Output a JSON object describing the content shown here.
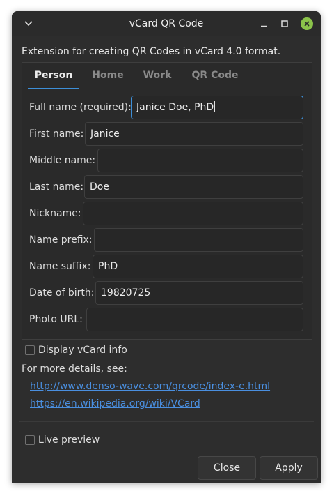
{
  "window": {
    "title": "vCard QR Code",
    "description": "Extension for creating QR Codes in vCard 4.0 format."
  },
  "tabs": [
    {
      "label": "Person",
      "active": true
    },
    {
      "label": "Home",
      "active": false
    },
    {
      "label": "Work",
      "active": false
    },
    {
      "label": "QR Code",
      "active": false
    }
  ],
  "fields": {
    "full_name": {
      "label": "Full name (required):",
      "value": "Janice Doe, PhD"
    },
    "first_name": {
      "label": "First name:",
      "value": "Janice"
    },
    "middle_name": {
      "label": "Middle name:",
      "value": ""
    },
    "last_name": {
      "label": "Last name:",
      "value": "Doe"
    },
    "nickname": {
      "label": "Nickname:",
      "value": ""
    },
    "name_prefix": {
      "label": "Name prefix:",
      "value": ""
    },
    "name_suffix": {
      "label": "Name suffix:",
      "value": "PhD"
    },
    "date_of_birth": {
      "label": "Date of birth:",
      "value": "19820725"
    },
    "photo_url": {
      "label": "Photo URL:",
      "value": ""
    }
  },
  "display_vcard": {
    "label": "Display vCard info",
    "checked": false
  },
  "details": {
    "text": "For more details, see:",
    "links": [
      "http://www.denso-wave.com/qrcode/index-e.html",
      "https://en.wikipedia.org/wiki/VCard"
    ]
  },
  "live_preview": {
    "label": "Live preview",
    "checked": false
  },
  "buttons": {
    "close": "Close",
    "apply": "Apply"
  },
  "colors": {
    "accent": "#3d8fd8",
    "link": "#4a8fe0",
    "close_button": "#8bc34a"
  }
}
